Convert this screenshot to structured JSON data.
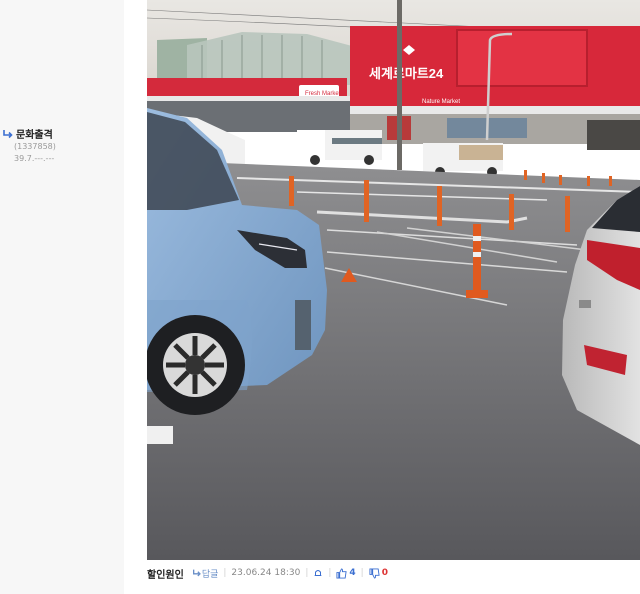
{
  "sidebar": {
    "reply_title": "문화출격",
    "reply_id": "(1337858)",
    "reply_ip": "39.7.---.---"
  },
  "post_footer": {
    "author": "할인원인",
    "author_link": "답글",
    "datetime": "23.06.24 18:30",
    "likes": "4",
    "dislikes": "0"
  },
  "photo": {
    "store_sign": "세계로마트24",
    "fresh_market_sign": "Fresh Market",
    "nature_market_sign": "Nature Market"
  },
  "colors": {
    "accent_blue": "#3b6fd1",
    "dislike_red": "#dd3333",
    "store_red": "#d7283a",
    "car_blue": "#8db0d4"
  }
}
